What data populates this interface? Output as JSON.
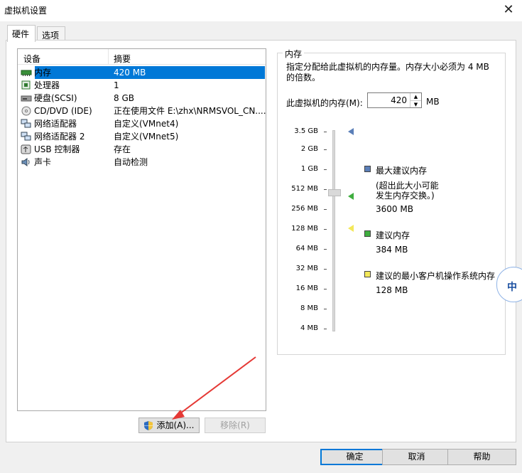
{
  "window": {
    "title": "虚拟机设置",
    "close_glyph": "✕"
  },
  "tabs": [
    {
      "label": "硬件",
      "active": true
    },
    {
      "label": "选项",
      "active": false
    }
  ],
  "devices": {
    "headers": {
      "device": "设备",
      "summary": "摘要"
    },
    "rows": [
      {
        "icon": "memory-icon",
        "name": "内存",
        "summary": "420 MB",
        "selected": true
      },
      {
        "icon": "processor-icon",
        "name": "处理器",
        "summary": "1"
      },
      {
        "icon": "hard-disk-icon",
        "name": "硬盘(SCSI)",
        "summary": "8 GB"
      },
      {
        "icon": "cd-dvd-icon",
        "name": "CD/DVD (IDE)",
        "summary": "正在使用文件 E:\\zhx\\NRMSVOL_CN...."
      },
      {
        "icon": "network-adapter-icon",
        "name": "网络适配器",
        "summary": "自定义(VMnet4)"
      },
      {
        "icon": "network-adapter-icon",
        "name": "网络适配器 2",
        "summary": "自定义(VMnet5)"
      },
      {
        "icon": "usb-icon",
        "name": "USB 控制器",
        "summary": "存在"
      },
      {
        "icon": "sound-card-icon",
        "name": "声卡",
        "summary": "自动检测"
      }
    ],
    "add_button": "添加(A)...",
    "remove_button": "移除(R)"
  },
  "memory": {
    "group_title": "内存",
    "description": "指定分配给此虚拟机的内存量。内存大小必须为 4 MB 的倍数。",
    "label": "此虚拟机的内存(M):",
    "value": "420",
    "unit": "MB",
    "scale_ticks": [
      "3.5 GB",
      "2 GB",
      "1 GB",
      "512 MB",
      "256 MB",
      "128 MB",
      "64 MB",
      "32 MB",
      "16 MB",
      "8 MB",
      "4 MB"
    ],
    "legend": {
      "max": {
        "title": "最大建议内存",
        "note_line1": "(超出此大小可能",
        "note_line2": "发生内存交换。)",
        "value": "3600 MB",
        "color": "#5b7fb8"
      },
      "recommended": {
        "title": "建议内存",
        "value": "384 MB",
        "color": "#3fae3f"
      },
      "min_guest": {
        "title": "建议的最小客户机操作系统内存",
        "value": "128 MB",
        "color": "#f3e85a"
      }
    }
  },
  "buttons": {
    "ok": "确定",
    "cancel": "取消",
    "help": "帮助"
  },
  "ime_indicator": "中",
  "colors": {
    "selection": "#0078d7",
    "accent": "#0078d7",
    "annotation_arrow": "#e53935"
  }
}
